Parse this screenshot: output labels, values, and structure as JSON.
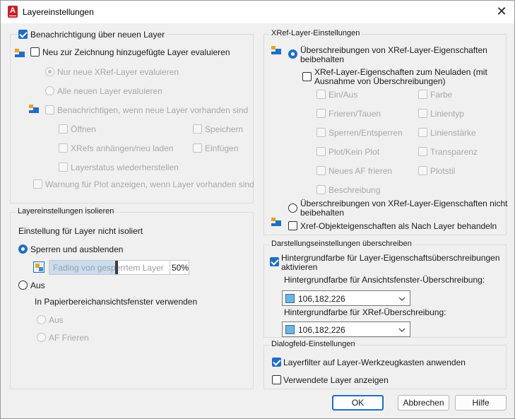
{
  "window": {
    "title": "Layereinstellungen",
    "close_glyph": "✕",
    "app_icon_letter": "A",
    "accent": "#1f6fc5"
  },
  "left_top": {
    "notify_new_layers": "Benachrichtigung über neuen Layer",
    "evaluate_added": "Neu zur Zeichnung hinzugefügte Layer evaluieren",
    "only_xref": "Nur neue XRef-Layer evaluieren",
    "all_new": "Alle neuen Layer evaluieren",
    "notify_present": "Benachrichtigen, wenn neue Layer vorhanden sind",
    "open": "Öffnen",
    "save": "Speichern",
    "attach_reload": "XRefs anhängen/neu laden",
    "insert": "Einfügen",
    "restore_state": "Layerstatus wiederherstellen",
    "plot_warning": "Warnung für Plot anzeigen, wenn Layer vorhanden sind"
  },
  "isolate": {
    "title": "Layereinstellungen isolieren",
    "subtitle": "Einstellung für Layer nicht isoliert",
    "lock_fade": "Sperren und ausblenden",
    "fade_label": "Fading von gesperrtem Layer",
    "fade_value": "50%",
    "fade_fraction": 0.5,
    "off": "Aus",
    "paper_space": "In Papierbereichansichtsfenster verwenden",
    "ps_off": "Aus",
    "ps_freeze": "AF Frieren"
  },
  "xref": {
    "title": "XRef-Layer-Einstellungen",
    "keep_overrides_1": "Überschreibungen von XRef-Layer-Eigenschaften",
    "keep_overrides_2": "beibehalten",
    "reload_props_1": "XRef-Layer-Eigenschaften zum Neuladen (mit",
    "reload_props_2": "Ausnahme von Überschreibungen)",
    "on_off": "Ein/Aus",
    "color": "Farbe",
    "freeze_thaw": "Frieren/Tauen",
    "linetype": "Linientyp",
    "lock_unlock": "Sperren/Entsperren",
    "lineweight": "Linienstärke",
    "plot_noplot": "Plot/Kein Plot",
    "transparency": "Transparenz",
    "new_vp_freeze": "Neues AF frieren",
    "plotstyle": "Plotstil",
    "description": "Beschreibung",
    "no_keep_1": "Überschreibungen von XRef-Layer-Eigenschaften nicht",
    "no_keep_2": "beibehalten",
    "object_bylayer": "Xref-Objekteigenschaften als Nach Layer behandeln"
  },
  "display": {
    "title": "Darstellungseinstellungen überschreiben",
    "bg_color_1": "Hintergrundfarbe für Layer-Eigenschaftsüberschreibungen",
    "bg_color_2": "aktivieren",
    "vp_label": "Hintergrundfarbe für Ansichtsfenster-Überschreibung:",
    "vp_value": "106,182,226",
    "xref_label": "Hintergrundfarbe für XRef-Überschreibung:",
    "xref_value": "106,182,226",
    "swatch_color": "#6ab6e2"
  },
  "dialog_settings": {
    "title": "Dialogfeld-Einstellungen",
    "apply_filter": "Layerfilter auf Layer-Werkzeugkasten anwenden",
    "show_used": "Verwendete Layer anzeigen"
  },
  "buttons": {
    "ok": "OK",
    "cancel": "Abbrechen",
    "help": "Hilfe"
  },
  "icons": {
    "layer": "layer-stack-icon",
    "fade": "fade-settings-icon",
    "chevron": "chevron-down-icon"
  }
}
